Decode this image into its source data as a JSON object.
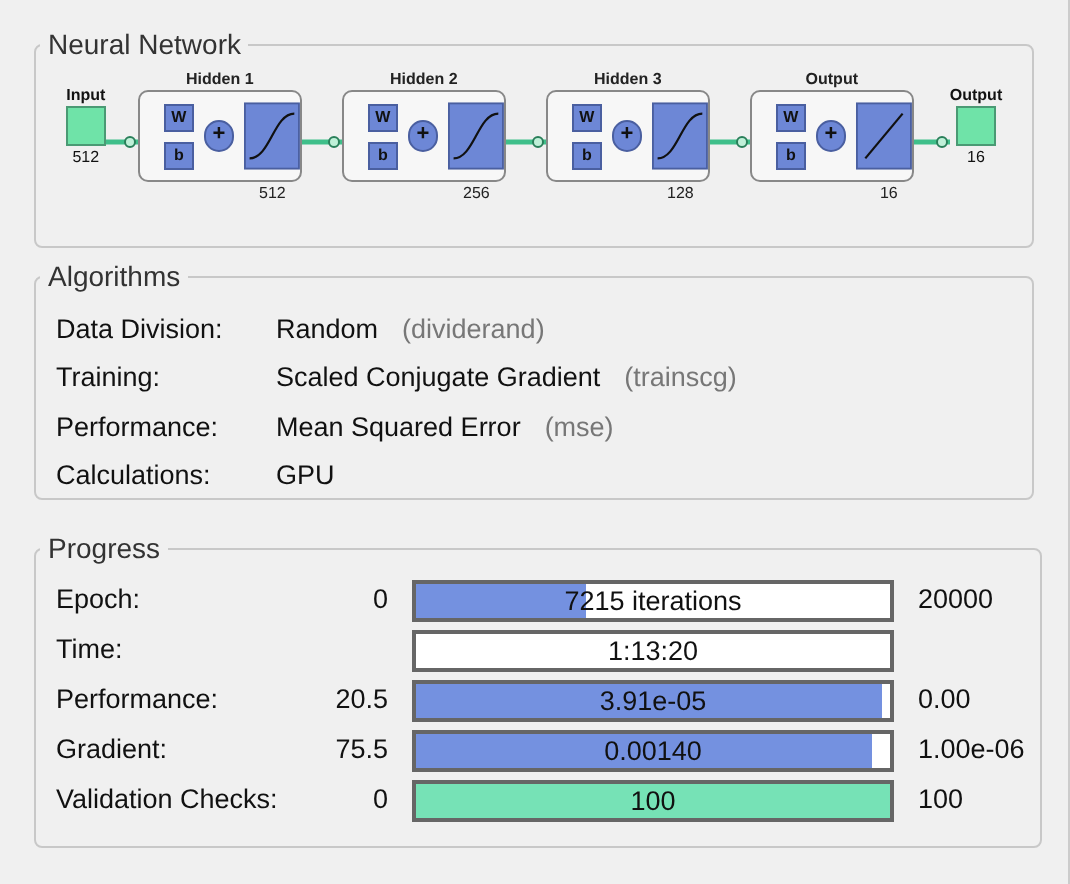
{
  "network": {
    "title": "Neural Network",
    "input": {
      "label": "Input",
      "size": "512"
    },
    "layers": [
      {
        "title": "Hidden 1",
        "size": "512",
        "kind": "sigmoid",
        "w": "W",
        "b": "b",
        "plus": "+"
      },
      {
        "title": "Hidden 2",
        "size": "256",
        "kind": "sigmoid",
        "w": "W",
        "b": "b",
        "plus": "+"
      },
      {
        "title": "Hidden 3",
        "size": "128",
        "kind": "sigmoid",
        "w": "W",
        "b": "b",
        "plus": "+"
      },
      {
        "title": "Output",
        "size": "16",
        "kind": "linear",
        "w": "W",
        "b": "b",
        "plus": "+"
      }
    ],
    "output": {
      "label": "Output",
      "size": "16"
    }
  },
  "algorithms": {
    "title": "Algorithms",
    "rows": [
      {
        "label": "Data Division:",
        "value": "Random",
        "code": "(dividerand)"
      },
      {
        "label": "Training:",
        "value": "Scaled Conjugate Gradient",
        "code": "(trainscg)"
      },
      {
        "label": "Performance:",
        "value": "Mean Squared Error",
        "code": "(mse)"
      },
      {
        "label": "Calculations:",
        "value": "GPU"
      }
    ]
  },
  "progress": {
    "title": "Progress",
    "rows": [
      {
        "label": "Epoch:",
        "start": "0",
        "reading": "7215 iterations",
        "end": "20000",
        "level": 0.36,
        "kind": "blue"
      },
      {
        "label": "Time:",
        "reading": "1:13:20"
      },
      {
        "label": "Performance:",
        "start": "20.5",
        "reading": "3.91e-05",
        "end": "0.00",
        "level": 0.985,
        "kind": "blue"
      },
      {
        "label": "Gradient:",
        "start": "75.5",
        "reading": "0.00140",
        "end": "1.00e-06",
        "level": 0.96,
        "kind": "blue"
      },
      {
        "label": "Validation Checks:",
        "start": "0",
        "reading": "100",
        "end": "100",
        "level": 1,
        "kind": "green"
      }
    ]
  }
}
